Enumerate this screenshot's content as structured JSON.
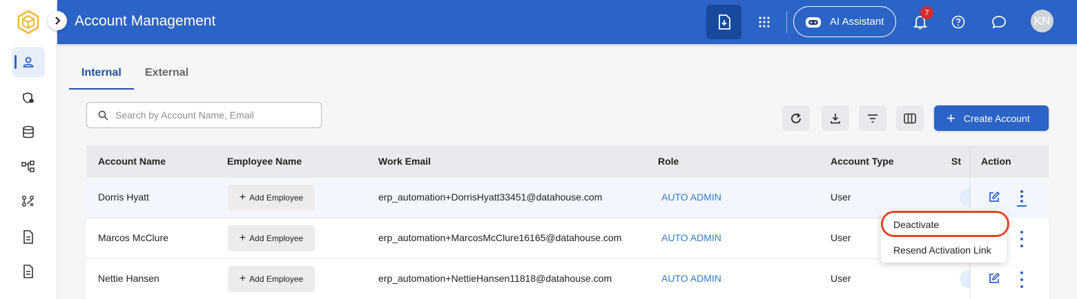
{
  "header": {
    "title": "Account Management",
    "ai_assistant_label": "AI Assistant",
    "notification_count": "7",
    "avatar_initials": "KN"
  },
  "tabs": [
    {
      "label": "Internal",
      "active": true
    },
    {
      "label": "External",
      "active": false
    }
  ],
  "search": {
    "placeholder": "Search by Account Name, Email",
    "value": ""
  },
  "toolbar": {
    "create_label": "Create Account"
  },
  "table": {
    "columns": [
      "Account Name",
      "Employee Name",
      "Work Email",
      "Role",
      "Account Type",
      "St",
      "Action"
    ],
    "rows": [
      {
        "account_name": "Dorris Hyatt",
        "employee_button": "Add Employee",
        "email": "erp_automation+DorrisHyatt33451@datahouse.com",
        "role": "AUTO ADMIN",
        "account_type": "User"
      },
      {
        "account_name": "Marcos McClure",
        "employee_button": "Add Employee",
        "email": "erp_automation+MarcosMcClure16165@datahouse.com",
        "role": "AUTO ADMIN",
        "account_type": "User"
      },
      {
        "account_name": "Nettie Hansen",
        "employee_button": "Add Employee",
        "email": "erp_automation+NettieHansen11818@datahouse.com",
        "role": "AUTO ADMIN",
        "account_type": "User"
      }
    ]
  },
  "row_menu": {
    "items": [
      "Deactivate",
      "Resend Activation Link"
    ],
    "highlighted": "Deactivate",
    "highlight_color": "#e0441f"
  },
  "colors": {
    "primary": "#2b63c6",
    "header_bg": "#2b63c6",
    "role_link": "#2f7bd0",
    "badge": "#d32f2f"
  }
}
